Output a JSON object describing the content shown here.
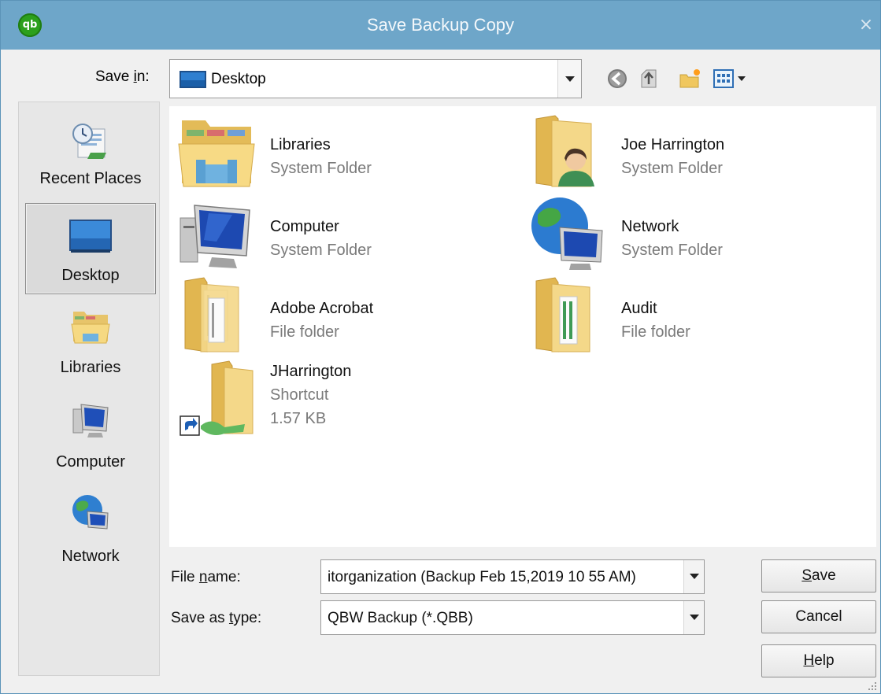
{
  "window": {
    "title": "Save Backup Copy",
    "app_icon_text": "qb",
    "close_glyph": "×"
  },
  "save_in": {
    "label_prefix": "Save ",
    "label_hotkey": "i",
    "label_suffix": "n:",
    "value": "Desktop"
  },
  "toolbar": {
    "icons": [
      "back-icon",
      "up-folder-icon",
      "new-folder-icon",
      "view-menu-icon"
    ]
  },
  "places": [
    {
      "label": "Recent Places",
      "icon": "recent-places-icon",
      "selected": false
    },
    {
      "label": "Desktop",
      "icon": "desktop-icon",
      "selected": true
    },
    {
      "label": "Libraries",
      "icon": "libraries-icon",
      "selected": false
    },
    {
      "label": "Computer",
      "icon": "computer-icon",
      "selected": false
    },
    {
      "label": "Network",
      "icon": "network-icon",
      "selected": false
    }
  ],
  "files": [
    {
      "name": "Libraries",
      "type": "System Folder",
      "icon": "libraries-folder-icon"
    },
    {
      "name": "Joe Harrington",
      "type": "System Folder",
      "icon": "user-folder-icon"
    },
    {
      "name": "Computer",
      "type": "System Folder",
      "icon": "computer-icon"
    },
    {
      "name": "Network",
      "type": "System Folder",
      "icon": "network-icon"
    },
    {
      "name": "Adobe Acrobat",
      "type": "File folder",
      "icon": "folder-icon"
    },
    {
      "name": "Audit",
      "type": "File folder",
      "icon": "folder-icon"
    },
    {
      "name": "JHarrington",
      "type": "Shortcut",
      "size": "1.57 KB",
      "icon": "shortcut-folder-icon"
    }
  ],
  "file_name": {
    "label_prefix": "File ",
    "label_hotkey": "n",
    "label_suffix": "ame:",
    "value": "itorganization (Backup Feb 15,2019  10 55 AM)"
  },
  "save_as_type": {
    "label_prefix": "Save as ",
    "label_hotkey": "t",
    "label_suffix": "ype:",
    "value": "QBW Backup (*.QBB)"
  },
  "buttons": {
    "save_hotkey": "S",
    "save_rest": "ave",
    "cancel": "Cancel",
    "help_hotkey": "H",
    "help_rest": "elp"
  },
  "colors": {
    "titlebar": "#6ea6c9",
    "quickbooks_green": "#2ca01c",
    "folder_yellow": "#f3d37a"
  }
}
